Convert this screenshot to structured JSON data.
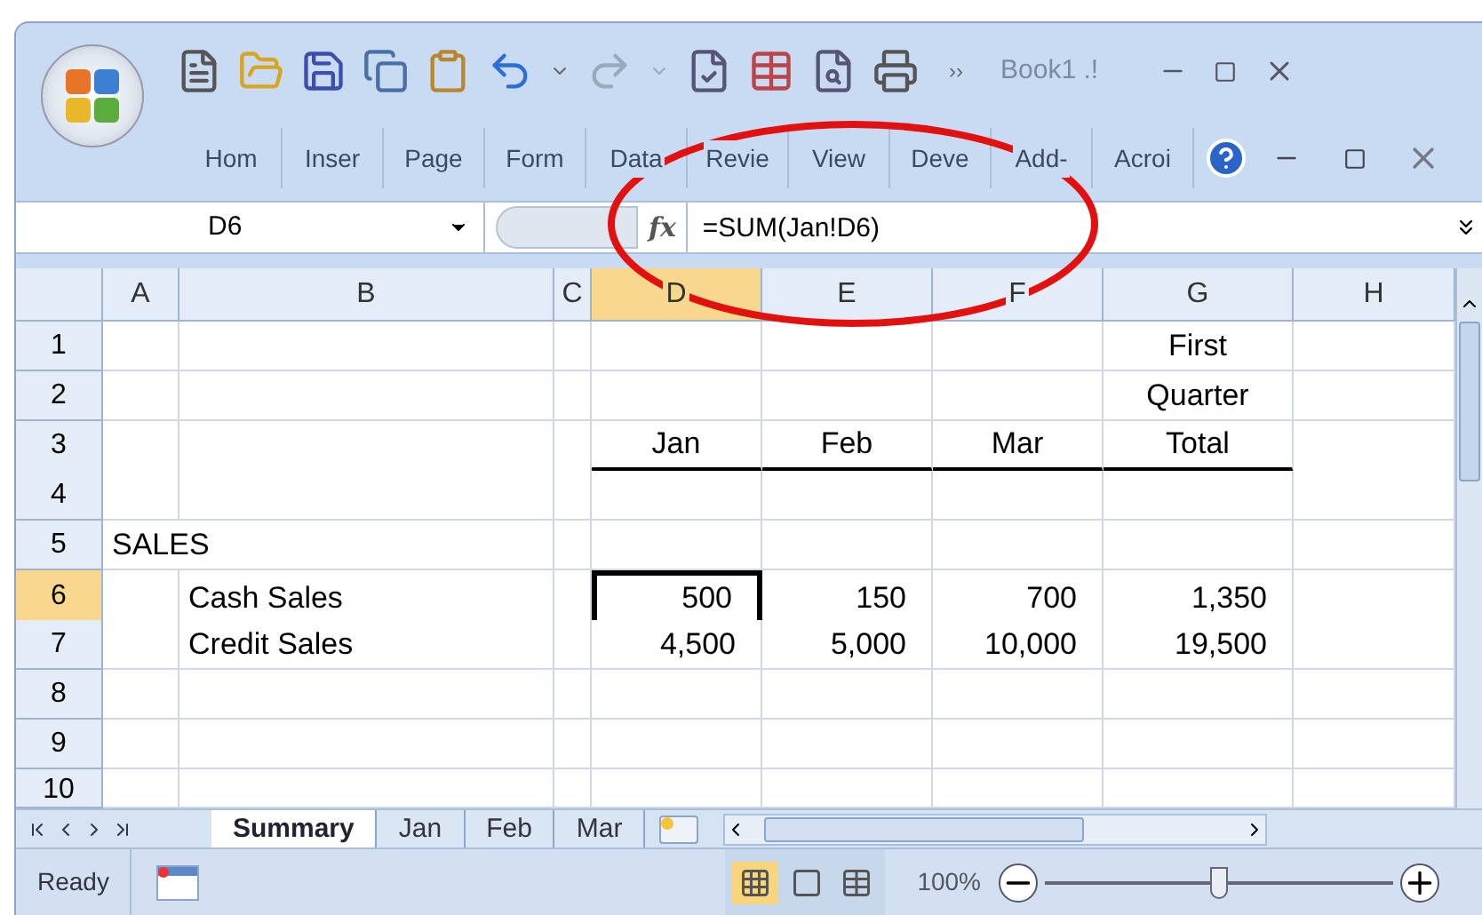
{
  "title_bar": {
    "overflow": "››",
    "title": "Book1 .!"
  },
  "ribbon_tabs": [
    {
      "label": "Hom"
    },
    {
      "label": "Inser"
    },
    {
      "label": "Page"
    },
    {
      "label": "Form"
    },
    {
      "label": "Data"
    },
    {
      "label": "Revie"
    },
    {
      "label": "View"
    },
    {
      "label": "Deve"
    },
    {
      "label": "Add-"
    },
    {
      "label": "Acroi"
    }
  ],
  "formula_bar": {
    "name_box": "D6",
    "fx": "fx",
    "formula": "=SUM(Jan!D6)"
  },
  "columns": [
    {
      "label": "A",
      "selected": false
    },
    {
      "label": "B",
      "selected": false
    },
    {
      "label": "C",
      "selected": false
    },
    {
      "label": "D",
      "selected": true
    },
    {
      "label": "E",
      "selected": false
    },
    {
      "label": "F",
      "selected": false
    },
    {
      "label": "G",
      "selected": false
    },
    {
      "label": "H",
      "selected": false
    }
  ],
  "rows": [
    {
      "header": "1",
      "selected": false,
      "cells": {
        "G": {
          "text": "First",
          "kind": "center",
          "underlined": false,
          "selected": false
        }
      }
    },
    {
      "header": "2",
      "selected": false,
      "cells": {
        "G": {
          "text": "Quarter",
          "kind": "center",
          "underlined": false,
          "selected": false
        }
      }
    },
    {
      "header": "3",
      "selected": false,
      "cells": {
        "D": {
          "text": "Jan",
          "kind": "center",
          "underlined": true,
          "selected": false
        },
        "E": {
          "text": "Feb",
          "kind": "center",
          "underlined": true,
          "selected": false
        },
        "F": {
          "text": "Mar",
          "kind": "center",
          "underlined": true,
          "selected": false
        },
        "G": {
          "text": "Total",
          "kind": "center",
          "underlined": true,
          "selected": false
        }
      }
    },
    {
      "header": "4",
      "selected": false
    },
    {
      "header": "5",
      "selected": false,
      "cells": {
        "A": {
          "text": "SALES",
          "kind": "text",
          "underlined": false,
          "selected": false
        }
      }
    },
    {
      "header": "6",
      "selected": true,
      "cells": {
        "B": {
          "text": "Cash Sales",
          "kind": "text",
          "underlined": false,
          "selected": false
        },
        "D": {
          "text": "500",
          "kind": "number",
          "underlined": false,
          "selected": true
        },
        "E": {
          "text": "150",
          "kind": "number",
          "underlined": false,
          "selected": false
        },
        "F": {
          "text": "700",
          "kind": "number",
          "underlined": false,
          "selected": false
        },
        "G": {
          "text": "1,350",
          "kind": "number",
          "underlined": false,
          "selected": false
        }
      }
    },
    {
      "header": "7",
      "selected": false,
      "cells": {
        "B": {
          "text": "Credit Sales",
          "kind": "text",
          "underlined": false,
          "selected": false
        },
        "D": {
          "text": "4,500",
          "kind": "number",
          "underlined": false,
          "selected": false
        },
        "E": {
          "text": "5,000",
          "kind": "number",
          "underlined": false,
          "selected": false
        },
        "F": {
          "text": "10,000",
          "kind": "number",
          "underlined": false,
          "selected": false
        },
        "G": {
          "text": "19,500",
          "kind": "number",
          "underlined": false,
          "selected": false
        }
      }
    },
    {
      "header": "8",
      "selected": false
    },
    {
      "header": "9",
      "selected": false
    },
    {
      "header": "10",
      "selected": false
    }
  ],
  "sheet_tabs": [
    {
      "label": "Summary",
      "selected": true
    },
    {
      "label": "Jan",
      "selected": false
    },
    {
      "label": "Feb",
      "selected": false
    },
    {
      "label": "Mar",
      "selected": false
    }
  ],
  "status_bar": {
    "status": "Ready",
    "zoom": "100%",
    "zoom_slider": {
      "level": 0.5
    }
  },
  "annotation": {
    "kind": "ellipse"
  }
}
